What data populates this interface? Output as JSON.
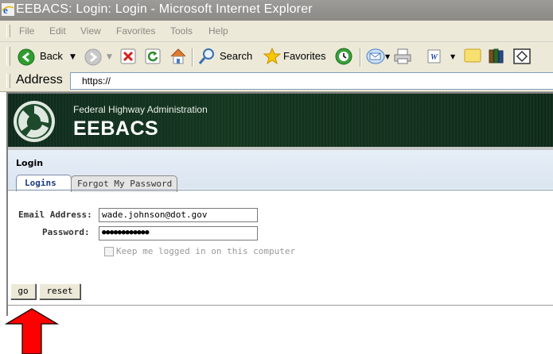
{
  "window": {
    "title": "EEBACS: Login: Login - Microsoft Internet Explorer"
  },
  "menu": {
    "items": [
      "File",
      "Edit",
      "View",
      "Favorites",
      "Tools",
      "Help"
    ]
  },
  "toolbar": {
    "back_label": "Back",
    "search_label": "Search",
    "favorites_label": "Favorites"
  },
  "address": {
    "label": "Address",
    "url": "https://"
  },
  "banner": {
    "agency": "Federal Highway Administration",
    "app_name": "EEBACS"
  },
  "page": {
    "section_title": "Login",
    "tabs": [
      {
        "label": "Logins",
        "active": true
      },
      {
        "label": "Forgot My Password",
        "active": false
      }
    ],
    "email_label": "Email Address:",
    "email_value": "wade.johnson@dot.gov",
    "password_label": "Password:",
    "password_value": "●●●●●●●●●●●●",
    "keep_logged_in_label": "Keep me logged in on this computer",
    "keep_logged_in_checked": false,
    "go_label": "go",
    "reset_label": "reset"
  },
  "colors": {
    "annotation_arrow": "#ff0000",
    "tab_active_text": "#1a3a80",
    "banner_bg": "#14361f"
  }
}
